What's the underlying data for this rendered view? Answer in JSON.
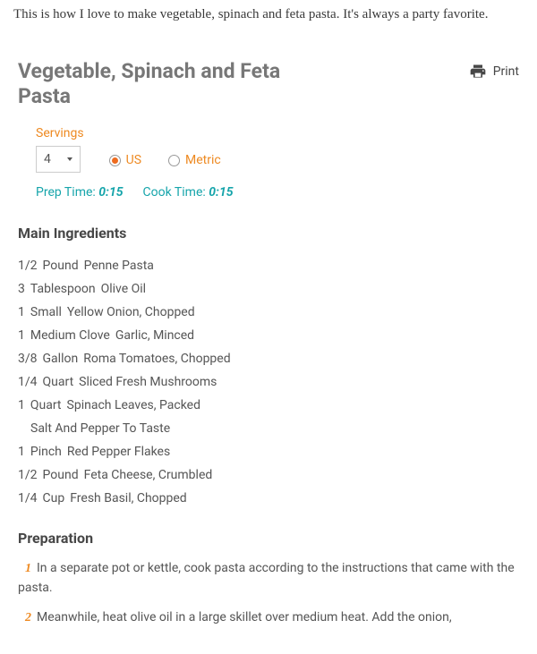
{
  "intro": "This is how I love to make vegetable, spinach and feta pasta. It's always a party favorite.",
  "recipe": {
    "title": "Vegetable, Spinach and Feta Pasta",
    "print_label": "Print",
    "servings_label": "Servings",
    "servings_value": "4",
    "unit_us": "US",
    "unit_metric": "Metric",
    "prep_label": "Prep Time:",
    "prep_value": "0:15",
    "cook_label": "Cook Time:",
    "cook_value": "0:15",
    "ingredients_heading": "Main Ingredients",
    "ingredients": [
      {
        "qty": "1/2",
        "unit": "Pound",
        "item": "Penne Pasta"
      },
      {
        "qty": "3",
        "unit": "Tablespoon",
        "item": "Olive Oil"
      },
      {
        "qty": "1",
        "unit": "Small",
        "item": "Yellow Onion, Chopped"
      },
      {
        "qty": "1",
        "unit": "Medium Clove",
        "item": "Garlic, Minced"
      },
      {
        "qty": "3/8",
        "unit": "Gallon",
        "item": "Roma Tomatoes, Chopped"
      },
      {
        "qty": "1/4",
        "unit": "Quart",
        "item": "Sliced Fresh Mushrooms"
      },
      {
        "qty": "1",
        "unit": "Quart",
        "item": "Spinach Leaves, Packed"
      },
      {
        "qty": "",
        "unit": "",
        "item": "Salt And Pepper To Taste"
      },
      {
        "qty": "1",
        "unit": "Pinch",
        "item": "Red Pepper Flakes"
      },
      {
        "qty": "1/2",
        "unit": "Pound",
        "item": "Feta Cheese, Crumbled"
      },
      {
        "qty": "1/4",
        "unit": "Cup",
        "item": "Fresh Basil, Chopped"
      }
    ],
    "preparation_heading": "Preparation",
    "steps": [
      "In a separate pot or kettle, cook pasta according to the instructions that came with the pasta.",
      "Meanwhile, heat olive oil in a large skillet over medium heat. Add the onion,"
    ]
  }
}
